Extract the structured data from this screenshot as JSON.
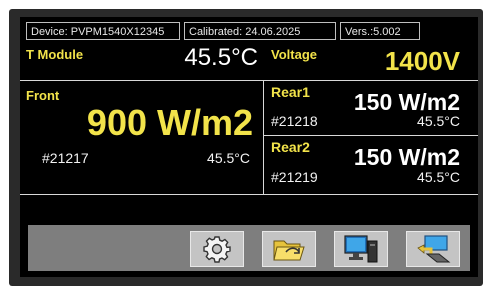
{
  "header": {
    "device": "Device: PVPM1540X12345",
    "calibrated": "Calibrated: 24.06.2025",
    "version": "Vers.:5.002"
  },
  "module": {
    "label": "T Module",
    "temperature": "45.5°C"
  },
  "voltage": {
    "label": "Voltage",
    "value": "1400V"
  },
  "front": {
    "label": "Front",
    "irradiance": "900 W/m2",
    "id": "#21217",
    "temperature": "45.5°C"
  },
  "rear1": {
    "label": "Rear1",
    "irradiance": "150 W/m2",
    "id": "#21218",
    "temperature": "45.5°C"
  },
  "rear2": {
    "label": "Rear2",
    "irradiance": "150 W/m2",
    "id": "#21219",
    "temperature": "45.5°C"
  },
  "toolbar": {
    "buttons": [
      "settings-icon",
      "open-folder-icon",
      "computer-icon",
      "transfer-icon"
    ]
  },
  "colors": {
    "accent_yellow": "#f2e34a",
    "screen_bg": "#000000",
    "toolbar_bg": "#7e7e7e"
  }
}
